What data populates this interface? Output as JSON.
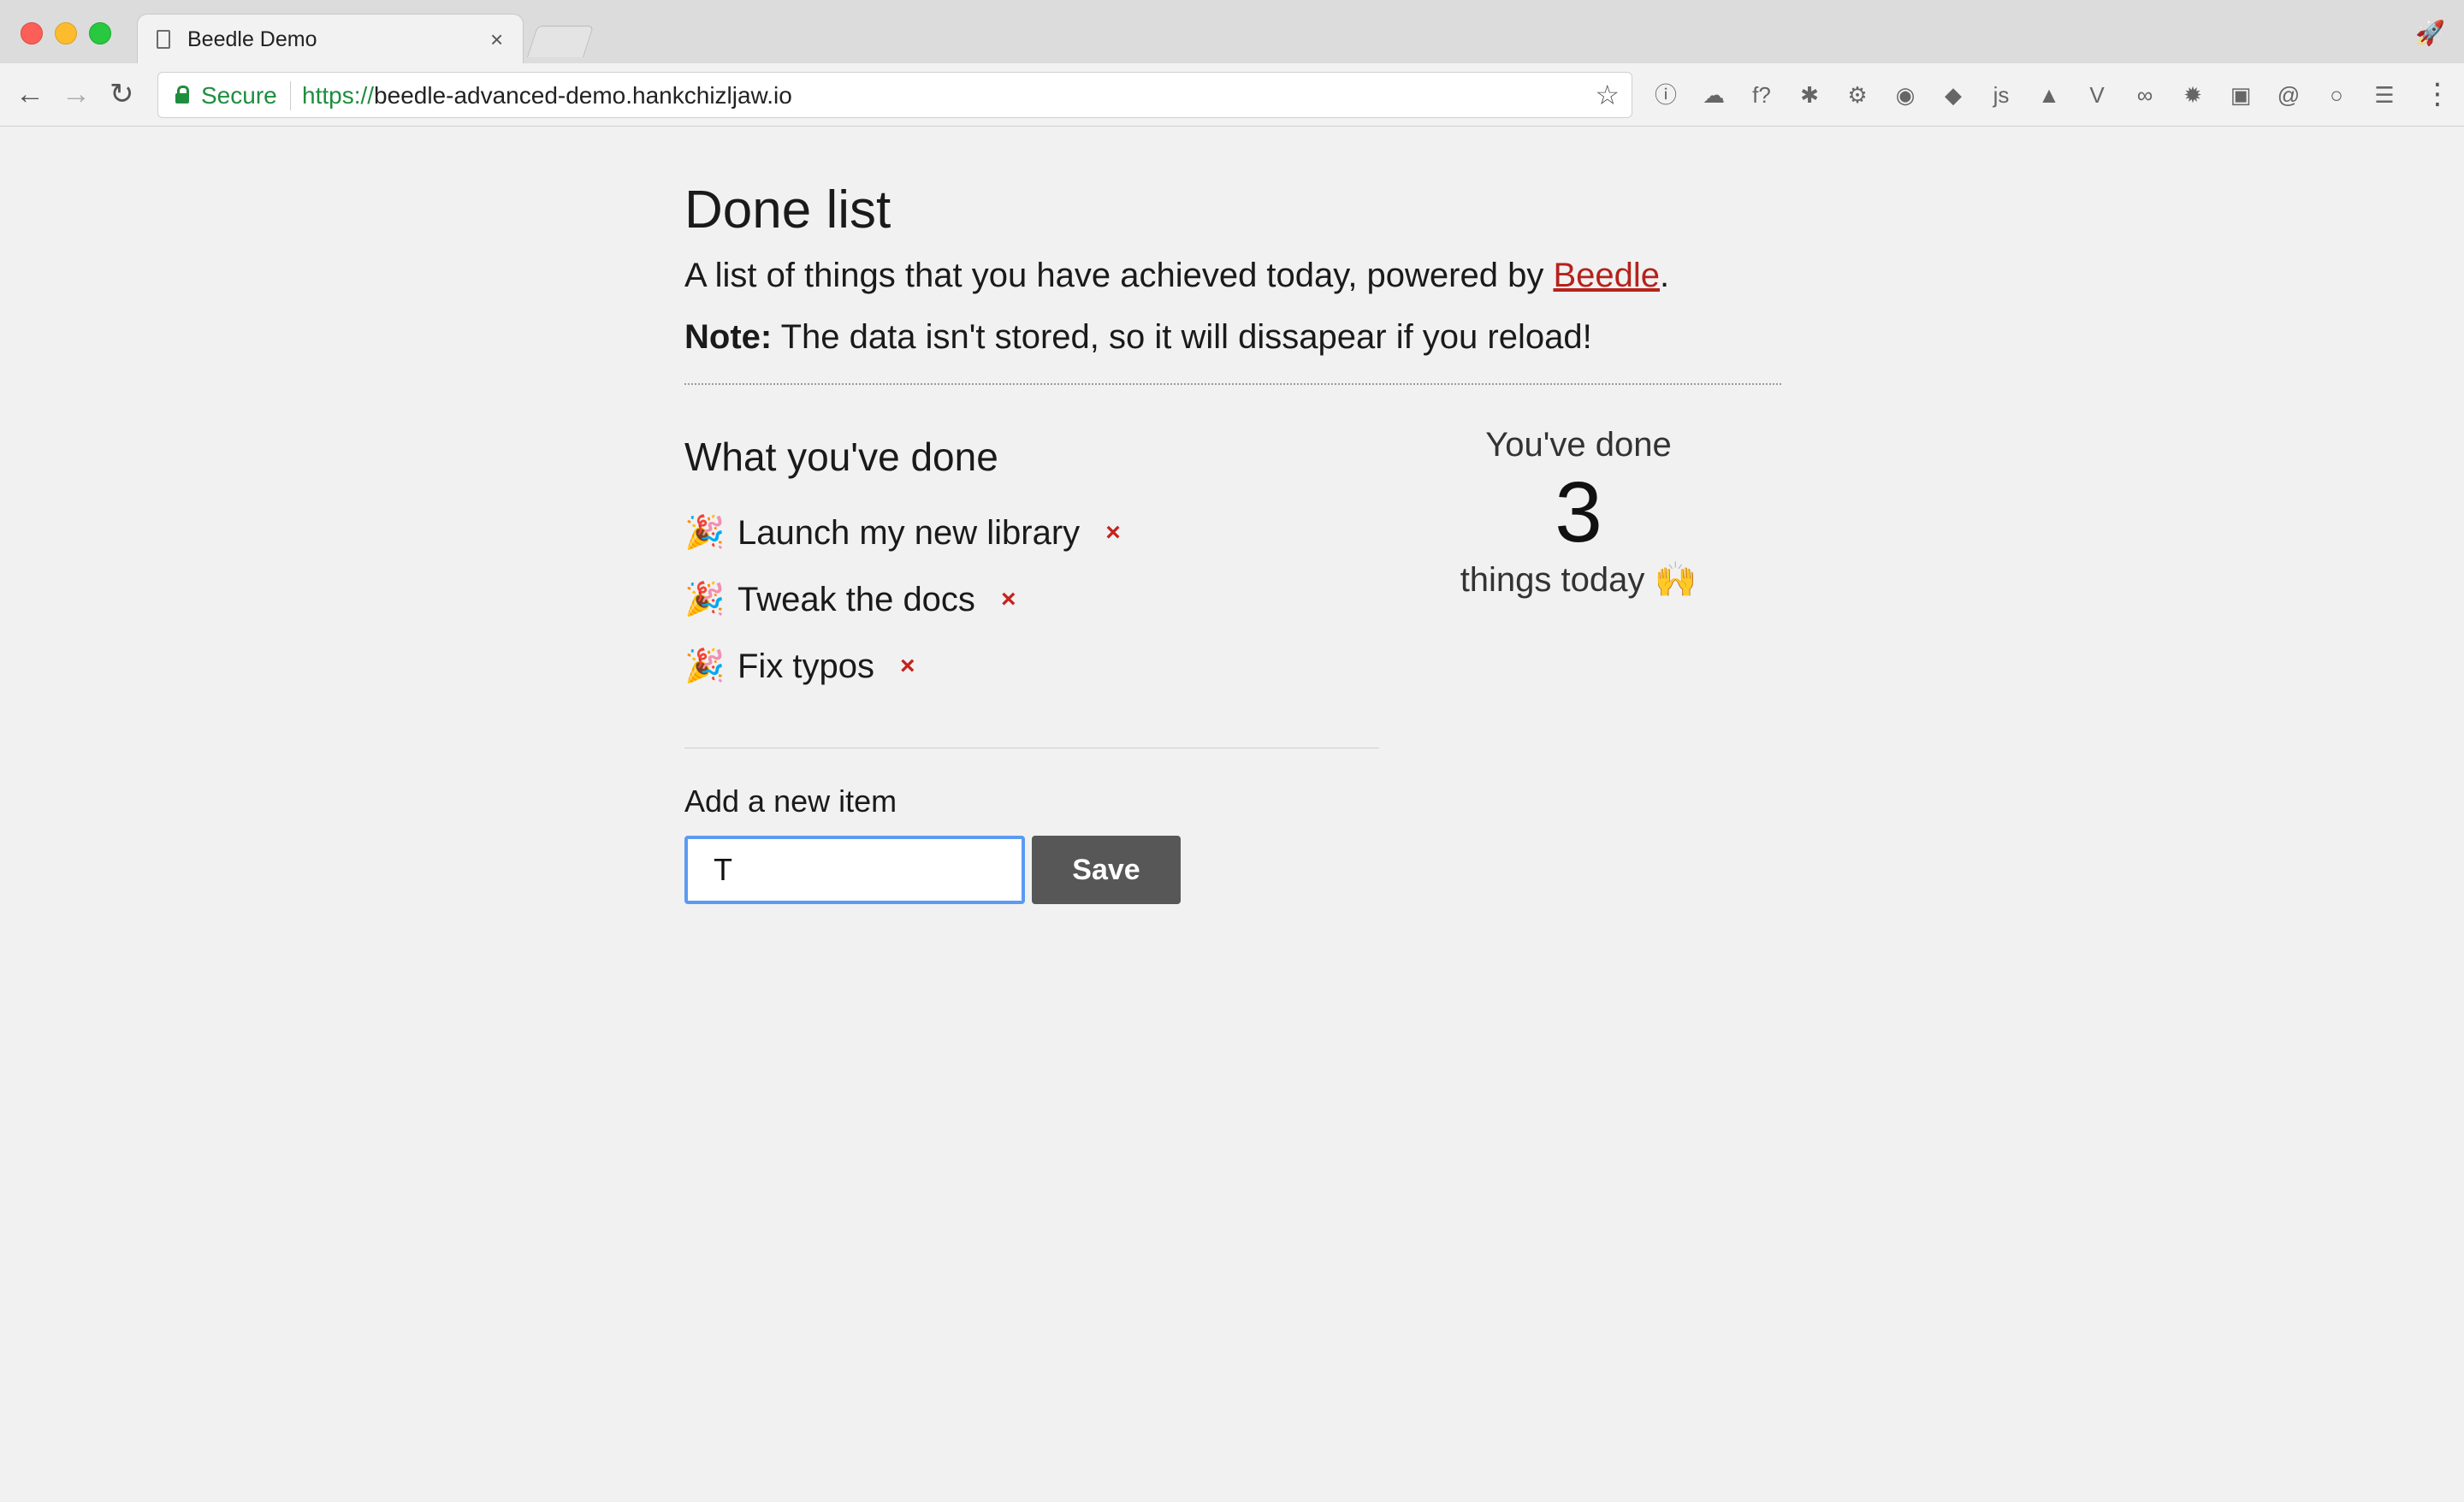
{
  "browser": {
    "tab_title": "Beedle Demo",
    "tab_close": "×",
    "secure_label": "Secure",
    "url_scheme": "https://",
    "url_host": "beedle-advanced-demo.hankchizljaw.io",
    "nav_back": "←",
    "nav_forward": "→",
    "nav_reload": "↻",
    "star": "☆",
    "menu": "⋮",
    "rocket": "🚀",
    "extensions": [
      {
        "name": "info-icon",
        "glyph": "ⓘ"
      },
      {
        "name": "cloud-icon",
        "glyph": "☁"
      },
      {
        "name": "font-icon",
        "glyph": "f?"
      },
      {
        "name": "bug-icon",
        "glyph": "✱"
      },
      {
        "name": "settings-icon",
        "glyph": "⚙"
      },
      {
        "name": "color-icon",
        "glyph": "◉"
      },
      {
        "name": "badge-icon",
        "glyph": "◆"
      },
      {
        "name": "js-icon",
        "glyph": "js"
      },
      {
        "name": "axe-icon",
        "glyph": "▲"
      },
      {
        "name": "vue-icon",
        "glyph": "V"
      },
      {
        "name": "glasses-icon",
        "glyph": "∞"
      },
      {
        "name": "gear-icon",
        "glyph": "✹"
      },
      {
        "name": "whatfont-icon",
        "glyph": "▣"
      },
      {
        "name": "at-icon",
        "glyph": "@"
      },
      {
        "name": "circle-icon",
        "glyph": "○"
      },
      {
        "name": "list-icon",
        "glyph": "☰"
      }
    ]
  },
  "page": {
    "title": "Done list",
    "intro_before": "A list of things that you have achieved today, powered by ",
    "intro_link": "Beedle",
    "intro_after": ".",
    "note_label": "Note:",
    "note_text": " The data isn't stored, so it will dissapear if you reload!",
    "done_heading": "What you've done",
    "items": [
      {
        "icon": "🎉",
        "text": "Launch my new library",
        "remove": "×"
      },
      {
        "icon": "🎉",
        "text": "Tweak the docs",
        "remove": "×"
      },
      {
        "icon": "🎉",
        "text": "Fix typos",
        "remove": "×"
      }
    ],
    "stats": {
      "top": "You've done",
      "count": "3",
      "bottom": "things today 🙌"
    },
    "add": {
      "label": "Add a new item",
      "input_value": "T",
      "save_label": "Save"
    }
  }
}
